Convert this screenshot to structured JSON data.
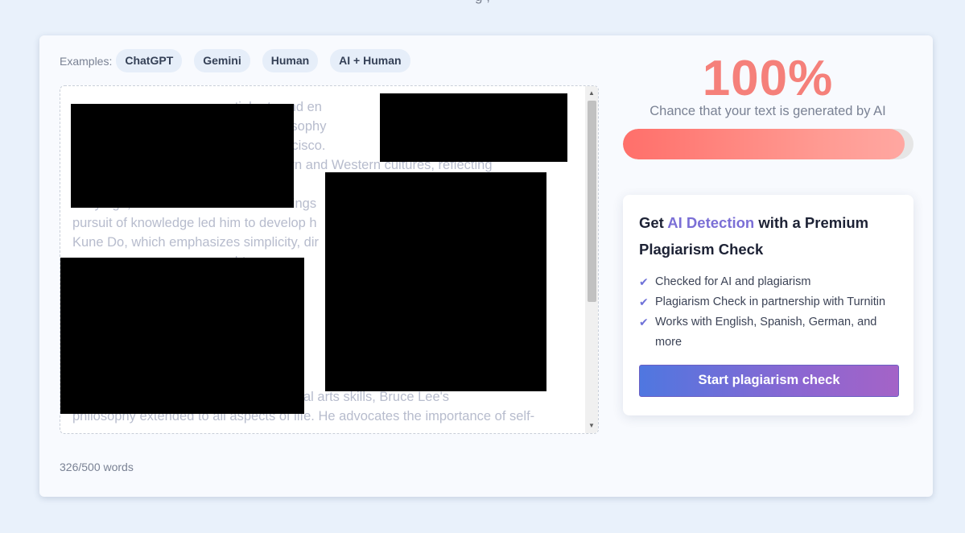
{
  "top_cut_text": "g                          ,",
  "examples": {
    "label": "Examples:",
    "chips": [
      "ChatGPT",
      "Gemini",
      "Human",
      "AI + Human"
    ]
  },
  "editor": {
    "text": "                                            tial arts and en\n                                              his philosophy\n                                               an Francisco.\n                                          d by Eastern and Western cultures, reflecting\n                                          ruce                                                   n\nearly age, thanks to his father's teachings                                            s\npursuit of knowledge led him to develop h\nKune Do, which emphasizes simplicity, dir\n                                          ght\n                                          dap\n                                          rso\n                                          e B                                                   ne\n                                          art\n                                          age                                                   ry\n                                          atus                                                  ons\n                                          n to his martial arts skills, Bruce Lee's\nphilosophy extended to all aspects of life. He advocates the importance of self-"
  },
  "word_count": "326/500 words",
  "result": {
    "percent": "100%",
    "chance_text": "Chance that your text is generated by AI",
    "bar_fill_fraction": 0.97
  },
  "premium": {
    "title_pre": "Get ",
    "title_highlight": "AI Detection",
    "title_post": " with a Premium Plagiarism Check",
    "features": [
      "Checked for AI and plagiarism",
      "Plagiarism Check in partnership with Turnitin",
      "Works with English, Spanish, German, and more"
    ],
    "cta_label": "Start plagiarism check"
  },
  "colors": {
    "percent": "#f5807a",
    "highlight": "#7b6fd6",
    "check": "#6f72d8"
  },
  "icons": {
    "check": "check-icon",
    "scroll_up": "scroll-up-arrow-icon",
    "scroll_down": "scroll-down-arrow-icon"
  }
}
